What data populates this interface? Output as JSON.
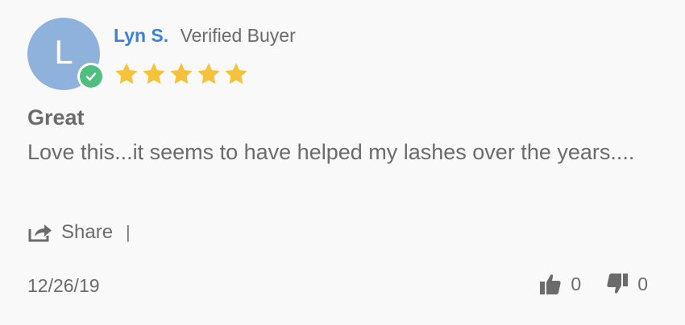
{
  "reviewer": {
    "initial": "L",
    "name": "Lyn S.",
    "badge_label": "Verified Buyer",
    "avatar_color": "#8fb2dd",
    "verified_icon": "check-icon",
    "verified_color": "#4fbf7f"
  },
  "rating": {
    "value": 5,
    "max": 5,
    "star_color": "#f5c33b"
  },
  "review": {
    "title": "Great",
    "body": "Love this...it seems to have helped my lashes over the years...."
  },
  "actions": {
    "share_label": "Share",
    "separator": "|"
  },
  "meta": {
    "date": "12/26/19"
  },
  "votes": {
    "up_count": "0",
    "down_count": "0"
  },
  "colors": {
    "name_link": "#3b82d6",
    "text": "#6b6b6b",
    "background": "#f9f9f9"
  }
}
